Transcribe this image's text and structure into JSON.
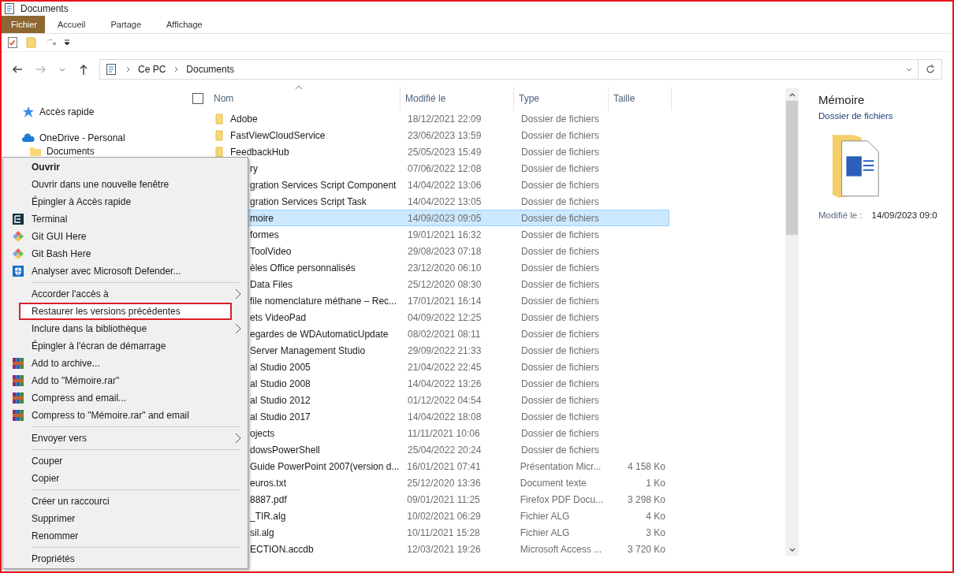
{
  "window": {
    "title": "Documents"
  },
  "ribbon_tabs": [
    {
      "label": "Fichier",
      "kind": "file"
    },
    {
      "label": "Accueil",
      "kind": "tab"
    },
    {
      "label": "Partage",
      "kind": "tab"
    },
    {
      "label": "Affichage",
      "kind": "tab"
    }
  ],
  "navigation": {
    "back_enabled": true,
    "forward_enabled": false
  },
  "address": {
    "crumbs": [
      "Ce PC",
      "Documents"
    ]
  },
  "sidebar": {
    "items": [
      {
        "label": "Accès rapide",
        "kind": "quick-access"
      },
      {
        "label": "OneDrive - Personal",
        "kind": "cloud",
        "children": [
          {
            "label": "Documents",
            "kind": "folder"
          }
        ]
      }
    ]
  },
  "table": {
    "select_all": {
      "checked": false
    },
    "columns": [
      "Nom",
      "Modifié le",
      "Type",
      "Taille"
    ],
    "rows": [
      {
        "name": "Adobe",
        "modified": "18/12/2021 22:09",
        "type": "Dossier de fichiers",
        "selected": false,
        "clipped": false
      },
      {
        "name": "FastViewCloudService",
        "modified": "23/06/2023 13:59",
        "type": "Dossier de fichiers",
        "selected": false,
        "clipped": false
      },
      {
        "name": "FeedbackHub",
        "modified": "25/05/2023 15:49",
        "type": "Dossier de fichiers",
        "selected": false,
        "clipped": false
      },
      {
        "name": "ry",
        "modified": "07/06/2022 12:08",
        "type": "Dossier de fichiers",
        "selected": false,
        "clipped": true
      },
      {
        "name": "gration Services Script Component",
        "modified": "14/04/2022 13:06",
        "type": "Dossier de fichiers",
        "selected": false,
        "clipped": true
      },
      {
        "name": "gration Services Script Task",
        "modified": "14/04/2022 13:05",
        "type": "Dossier de fichiers",
        "selected": false,
        "clipped": true
      },
      {
        "name": "moire",
        "modified": "14/09/2023 09:05",
        "type": "Dossier de fichiers",
        "selected": true,
        "clipped": true
      },
      {
        "name": "formes",
        "modified": "19/01/2021 16:32",
        "type": "Dossier de fichiers",
        "selected": false,
        "clipped": true
      },
      {
        "name": "ToolVideo",
        "modified": "29/08/2023 07:18",
        "type": "Dossier de fichiers",
        "selected": false,
        "clipped": true
      },
      {
        "name": "èles Office personnalisés",
        "modified": "23/12/2020 06:10",
        "type": "Dossier de fichiers",
        "selected": false,
        "clipped": true
      },
      {
        "name": "Data Files",
        "modified": "25/12/2020 08:30",
        "type": "Dossier de fichiers",
        "selected": false,
        "clipped": true
      },
      {
        "name": "file nomenclature méthane – Rec...",
        "modified": "17/01/2021 16:14",
        "type": "Dossier de fichiers",
        "selected": false,
        "clipped": true
      },
      {
        "name": "ets VideoPad",
        "modified": "04/09/2022 12:25",
        "type": "Dossier de fichiers",
        "selected": false,
        "clipped": true
      },
      {
        "name": "egardes de WDAutomaticUpdate",
        "modified": "08/02/2021 08:11",
        "type": "Dossier de fichiers",
        "selected": false,
        "clipped": true
      },
      {
        "name": "Server Management Studio",
        "modified": "29/09/2022 21:33",
        "type": "Dossier de fichiers",
        "selected": false,
        "clipped": true
      },
      {
        "name": "al Studio 2005",
        "modified": "21/04/2022 22:45",
        "type": "Dossier de fichiers",
        "selected": false,
        "clipped": true
      },
      {
        "name": "al Studio 2008",
        "modified": "14/04/2022 13:26",
        "type": "Dossier de fichiers",
        "selected": false,
        "clipped": true
      },
      {
        "name": "al Studio 2012",
        "modified": "01/12/2022 04:54",
        "type": "Dossier de fichiers",
        "selected": false,
        "clipped": true
      },
      {
        "name": "al Studio 2017",
        "modified": "14/04/2022 18:08",
        "type": "Dossier de fichiers",
        "selected": false,
        "clipped": true
      },
      {
        "name": "ojects",
        "modified": "11/11/2021 10:06",
        "type": "Dossier de fichiers",
        "selected": false,
        "clipped": true
      },
      {
        "name": "dowsPowerShell",
        "modified": "25/04/2022 20:24",
        "type": "Dossier de fichiers",
        "selected": false,
        "clipped": true
      },
      {
        "name": "Guide PowerPoint 2007(version d...",
        "modified": "16/01/2021 07:41",
        "type": "Présentation Micr...",
        "size": "4 158 Ko",
        "selected": false,
        "clipped": true
      },
      {
        "name": "euros.txt",
        "modified": "25/12/2020 13:36",
        "type": "Document texte",
        "size": "1 Ko",
        "selected": false,
        "clipped": true
      },
      {
        "name": "8887.pdf",
        "modified": "09/01/2021 11:25",
        "type": "Firefox PDF Docu...",
        "size": "3 298 Ko",
        "selected": false,
        "clipped": true
      },
      {
        "name": "_TIR.alg",
        "modified": "10/02/2021 06:29",
        "type": "Fichier ALG",
        "size": "4 Ko",
        "selected": false,
        "clipped": true
      },
      {
        "name": "sil.alg",
        "modified": "10/11/2021 15:28",
        "type": "Fichier ALG",
        "size": "3 Ko",
        "selected": false,
        "clipped": true
      },
      {
        "name": "ECTION.accdb",
        "modified": "12/03/2021 19:26",
        "type": "Microsoft Access ...",
        "size": "3 720 Ko",
        "selected": false,
        "clipped": true
      }
    ]
  },
  "details": {
    "title": "Mémoire",
    "subtitle": "Dossier de fichiers",
    "modified_label": "Modifié le :",
    "modified_value": "14/09/2023 09:0"
  },
  "context_menu": [
    {
      "kind": "item",
      "label": "Ouvrir",
      "bold": true
    },
    {
      "kind": "item",
      "label": "Ouvrir dans une nouvelle fenêtre"
    },
    {
      "kind": "item",
      "label": "Épingler à Accès rapide"
    },
    {
      "kind": "terminal",
      "label": "Terminal"
    },
    {
      "kind": "git",
      "label": "Git GUI Here"
    },
    {
      "kind": "git",
      "label": "Git Bash Here"
    },
    {
      "kind": "defender",
      "label": "Analyser avec Microsoft Defender..."
    },
    {
      "kind": "separator"
    },
    {
      "kind": "item",
      "label": "Accorder l'accès à",
      "submenu": true
    },
    {
      "kind": "item",
      "label": "Restaurer les versions précédentes",
      "highlighted": true
    },
    {
      "kind": "item",
      "label": "Inclure dans la bibliothèque",
      "submenu": true
    },
    {
      "kind": "item",
      "label": "Épingler à l'écran de démarrage"
    },
    {
      "kind": "archive",
      "label": "Add to archive..."
    },
    {
      "kind": "archive",
      "label": "Add to \"Mémoire.rar\""
    },
    {
      "kind": "archive",
      "label": "Compress and email..."
    },
    {
      "kind": "archive",
      "label": "Compress to \"Mémoire.rar\" and email"
    },
    {
      "kind": "separator"
    },
    {
      "kind": "item",
      "label": "Envoyer vers",
      "submenu": true
    },
    {
      "kind": "separator"
    },
    {
      "kind": "item",
      "label": "Couper"
    },
    {
      "kind": "item",
      "label": "Copier"
    },
    {
      "kind": "separator"
    },
    {
      "kind": "item",
      "label": "Créer un raccourci"
    },
    {
      "kind": "item",
      "label": "Supprimer"
    },
    {
      "kind": "item",
      "label": "Renommer"
    },
    {
      "kind": "separator"
    },
    {
      "kind": "item",
      "label": "Propriétés"
    }
  ]
}
